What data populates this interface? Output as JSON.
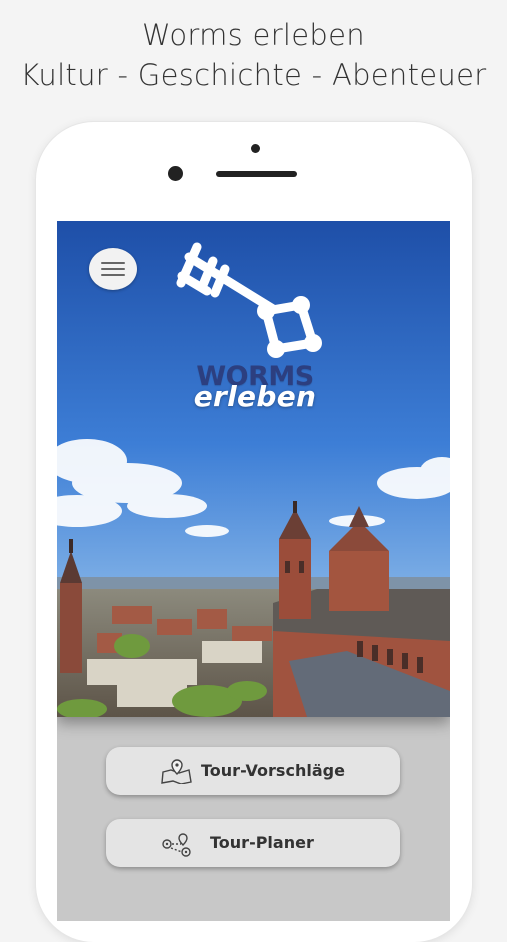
{
  "header": {
    "title": "Worms erleben",
    "subtitle": "Kultur - Geschichte - Abenteuer"
  },
  "app": {
    "logo": {
      "line1": "WORMS",
      "line2": "erleben"
    },
    "menu_icon": "hamburger-menu-icon",
    "buttons": [
      {
        "label": "Tour-Vorschläge",
        "icon": "map-pin-icon"
      },
      {
        "label": "Tour-Planer",
        "icon": "route-planner-icon"
      }
    ]
  },
  "colors": {
    "background": "#f4f4f4",
    "sky_top": "#1e4fa8",
    "logo_blue": "#2c3f80",
    "button": "#e4e4e4",
    "button_text": "#333333"
  }
}
